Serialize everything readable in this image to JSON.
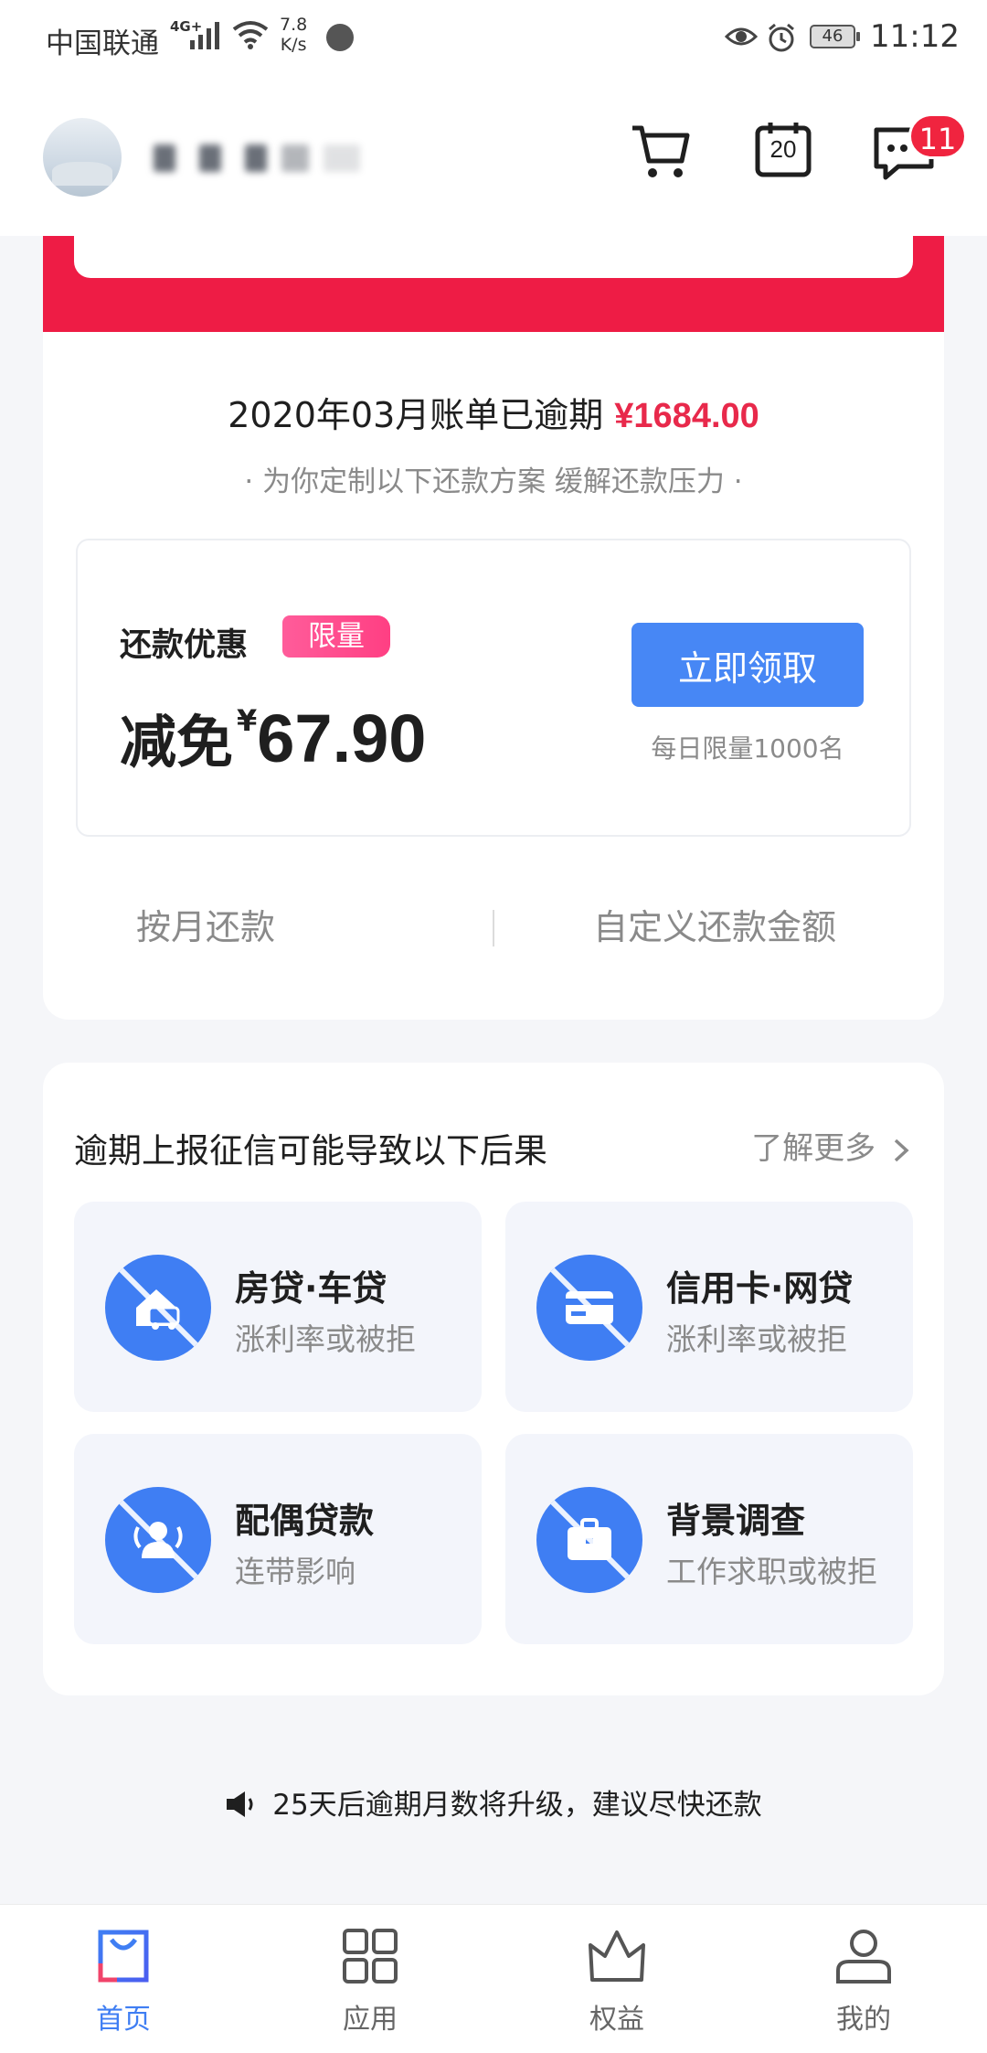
{
  "status_bar": {
    "carrier": "中国联通",
    "network": "4G+",
    "speed_value": "7.8",
    "speed_unit": "K/s",
    "battery": "46",
    "time": "11:12"
  },
  "header": {
    "notification_count": "11",
    "calendar_day": "20",
    "icons": [
      "avatar",
      "cart-icon",
      "calendar-icon",
      "message-icon"
    ]
  },
  "bill": {
    "title": "2020年03月账单已逾期",
    "amount": "¥1684.00",
    "subtitle": "· 为你定制以下还款方案 缓解还款压力 ·",
    "promo": {
      "label": "还款优惠",
      "tag": "限量",
      "discount_prefix": "减免",
      "currency": "¥",
      "discount_value": "67.90",
      "button": "立即领取",
      "daily_limit": "每日限量1000名"
    },
    "options": [
      "按月还款",
      "自定义还款金额"
    ]
  },
  "consequences": {
    "title": "逾期上报征信可能导致以下后果",
    "learn_more": "了解更多",
    "items": [
      {
        "title": "房贷·车贷",
        "subtitle": "涨利率或被拒",
        "icon": "house-car-icon"
      },
      {
        "title": "信用卡·网贷",
        "subtitle": "涨利率或被拒",
        "icon": "credit-card-icon"
      },
      {
        "title": "配偶贷款",
        "subtitle": "连带影响",
        "icon": "spouse-icon"
      },
      {
        "title": "背景调查",
        "subtitle": "工作求职或被拒",
        "icon": "briefcase-icon"
      }
    ]
  },
  "notice": "25天后逾期月数将升级，建议尽快还款",
  "bottom_nav": [
    {
      "label": "首页",
      "icon": "home-bag-icon",
      "active": true
    },
    {
      "label": "应用",
      "icon": "apps-grid-icon",
      "active": false
    },
    {
      "label": "权益",
      "icon": "crown-icon",
      "active": false
    },
    {
      "label": "我的",
      "icon": "profile-icon",
      "active": false
    }
  ],
  "colors": {
    "accent_blue": "#4787f5",
    "alert_red": "#ee1c45",
    "tag_pink": "#ff4f8f",
    "text_gray": "#8a8a8a"
  }
}
